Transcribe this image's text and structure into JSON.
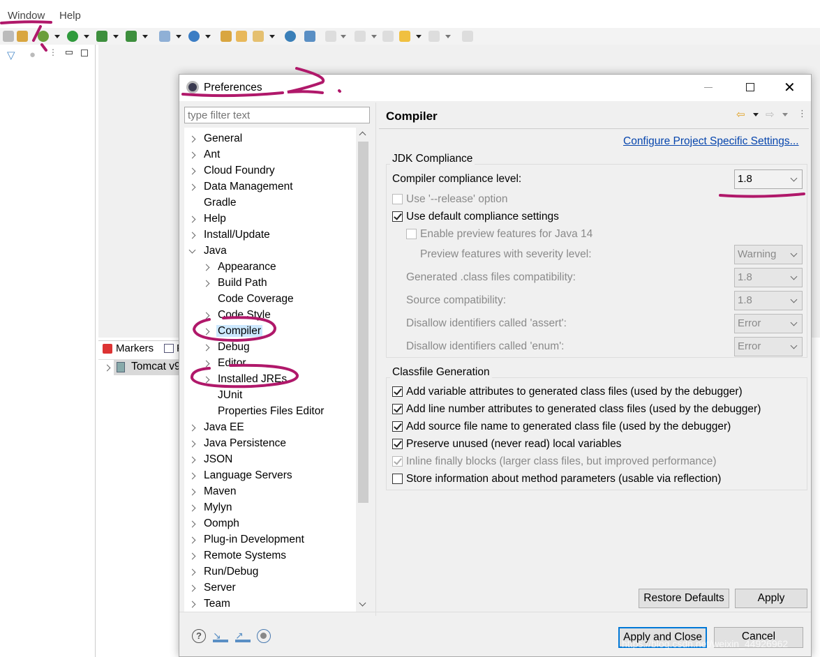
{
  "menubar": {
    "items": [
      "Window",
      "Help"
    ]
  },
  "left_panel": {
    "tree": {
      "item": "Tomcat v9"
    }
  },
  "bottom_panel": {
    "tabs": [
      "Markers",
      "P"
    ]
  },
  "dialog": {
    "title": "Preferences",
    "filter_placeholder": "type filter text",
    "tree": [
      {
        "label": "General",
        "level": 0,
        "expandable": true
      },
      {
        "label": "Ant",
        "level": 0,
        "expandable": true
      },
      {
        "label": "Cloud Foundry",
        "level": 0,
        "expandable": true
      },
      {
        "label": "Data Management",
        "level": 0,
        "expandable": true
      },
      {
        "label": "Gradle",
        "level": 0,
        "expandable": false
      },
      {
        "label": "Help",
        "level": 0,
        "expandable": true
      },
      {
        "label": "Install/Update",
        "level": 0,
        "expandable": true
      },
      {
        "label": "Java",
        "level": 0,
        "expandable": true,
        "expanded": true
      },
      {
        "label": "Appearance",
        "level": 1,
        "expandable": true
      },
      {
        "label": "Build Path",
        "level": 1,
        "expandable": true
      },
      {
        "label": "Code Coverage",
        "level": 1,
        "expandable": false
      },
      {
        "label": "Code Style",
        "level": 1,
        "expandable": true
      },
      {
        "label": "Compiler",
        "level": 1,
        "expandable": true,
        "selected": true
      },
      {
        "label": "Debug",
        "level": 1,
        "expandable": true
      },
      {
        "label": "Editor",
        "level": 1,
        "expandable": true
      },
      {
        "label": "Installed JREs",
        "level": 1,
        "expandable": true
      },
      {
        "label": "JUnit",
        "level": 1,
        "expandable": false
      },
      {
        "label": "Properties Files Editor",
        "level": 1,
        "expandable": false
      },
      {
        "label": "Java EE",
        "level": 0,
        "expandable": true
      },
      {
        "label": "Java Persistence",
        "level": 0,
        "expandable": true
      },
      {
        "label": "JSON",
        "level": 0,
        "expandable": true
      },
      {
        "label": "Language Servers",
        "level": 0,
        "expandable": true
      },
      {
        "label": "Maven",
        "level": 0,
        "expandable": true
      },
      {
        "label": "Mylyn",
        "level": 0,
        "expandable": true
      },
      {
        "label": "Oomph",
        "level": 0,
        "expandable": true
      },
      {
        "label": "Plug-in Development",
        "level": 0,
        "expandable": true
      },
      {
        "label": "Remote Systems",
        "level": 0,
        "expandable": true
      },
      {
        "label": "Run/Debug",
        "level": 0,
        "expandable": true
      },
      {
        "label": "Server",
        "level": 0,
        "expandable": true
      },
      {
        "label": "Team",
        "level": 0,
        "expandable": true
      }
    ],
    "page": {
      "title": "Compiler",
      "project_link": "Configure Project Specific Settings...",
      "jdk_group": "JDK Compliance",
      "compliance_label": "Compiler compliance level:",
      "compliance_value": "1.8",
      "release_option": "Use '--release' option",
      "use_default": "Use default compliance settings",
      "enable_preview": "Enable preview features for Java 14",
      "preview_severity_label": "Preview features with severity level:",
      "preview_severity_value": "Warning",
      "class_compat_label": "Generated .class files compatibility:",
      "class_compat_value": "1.8",
      "source_compat_label": "Source compatibility:",
      "source_compat_value": "1.8",
      "assert_label": "Disallow identifiers called 'assert':",
      "assert_value": "Error",
      "enum_label": "Disallow identifiers called 'enum':",
      "enum_value": "Error",
      "classfile_group": "Classfile Generation",
      "classfile_options": [
        {
          "label": "Add variable attributes to generated class files (used by the debugger)",
          "checked": true,
          "enabled": true
        },
        {
          "label": "Add line number attributes to generated class files (used by the debugger)",
          "checked": true,
          "enabled": true
        },
        {
          "label": "Add source file name to generated class file (used by the debugger)",
          "checked": true,
          "enabled": true
        },
        {
          "label": "Preserve unused (never read) local variables",
          "checked": true,
          "enabled": true
        },
        {
          "label": "Inline finally blocks (larger class files, but improved performance)",
          "checked": true,
          "enabled": false
        },
        {
          "label": "Store information about method parameters (usable via reflection)",
          "checked": false,
          "enabled": true
        }
      ],
      "restore_defaults": "Restore Defaults",
      "apply": "Apply"
    },
    "apply_and_close": "Apply and Close",
    "cancel": "Cancel"
  },
  "watermark": "https://blog.csdn.net/weixin_44926962",
  "colors": {
    "annotation": "#b0186a",
    "selection": "#cce8ff",
    "link": "#0645ad",
    "default_button_border": "#0078d7"
  }
}
